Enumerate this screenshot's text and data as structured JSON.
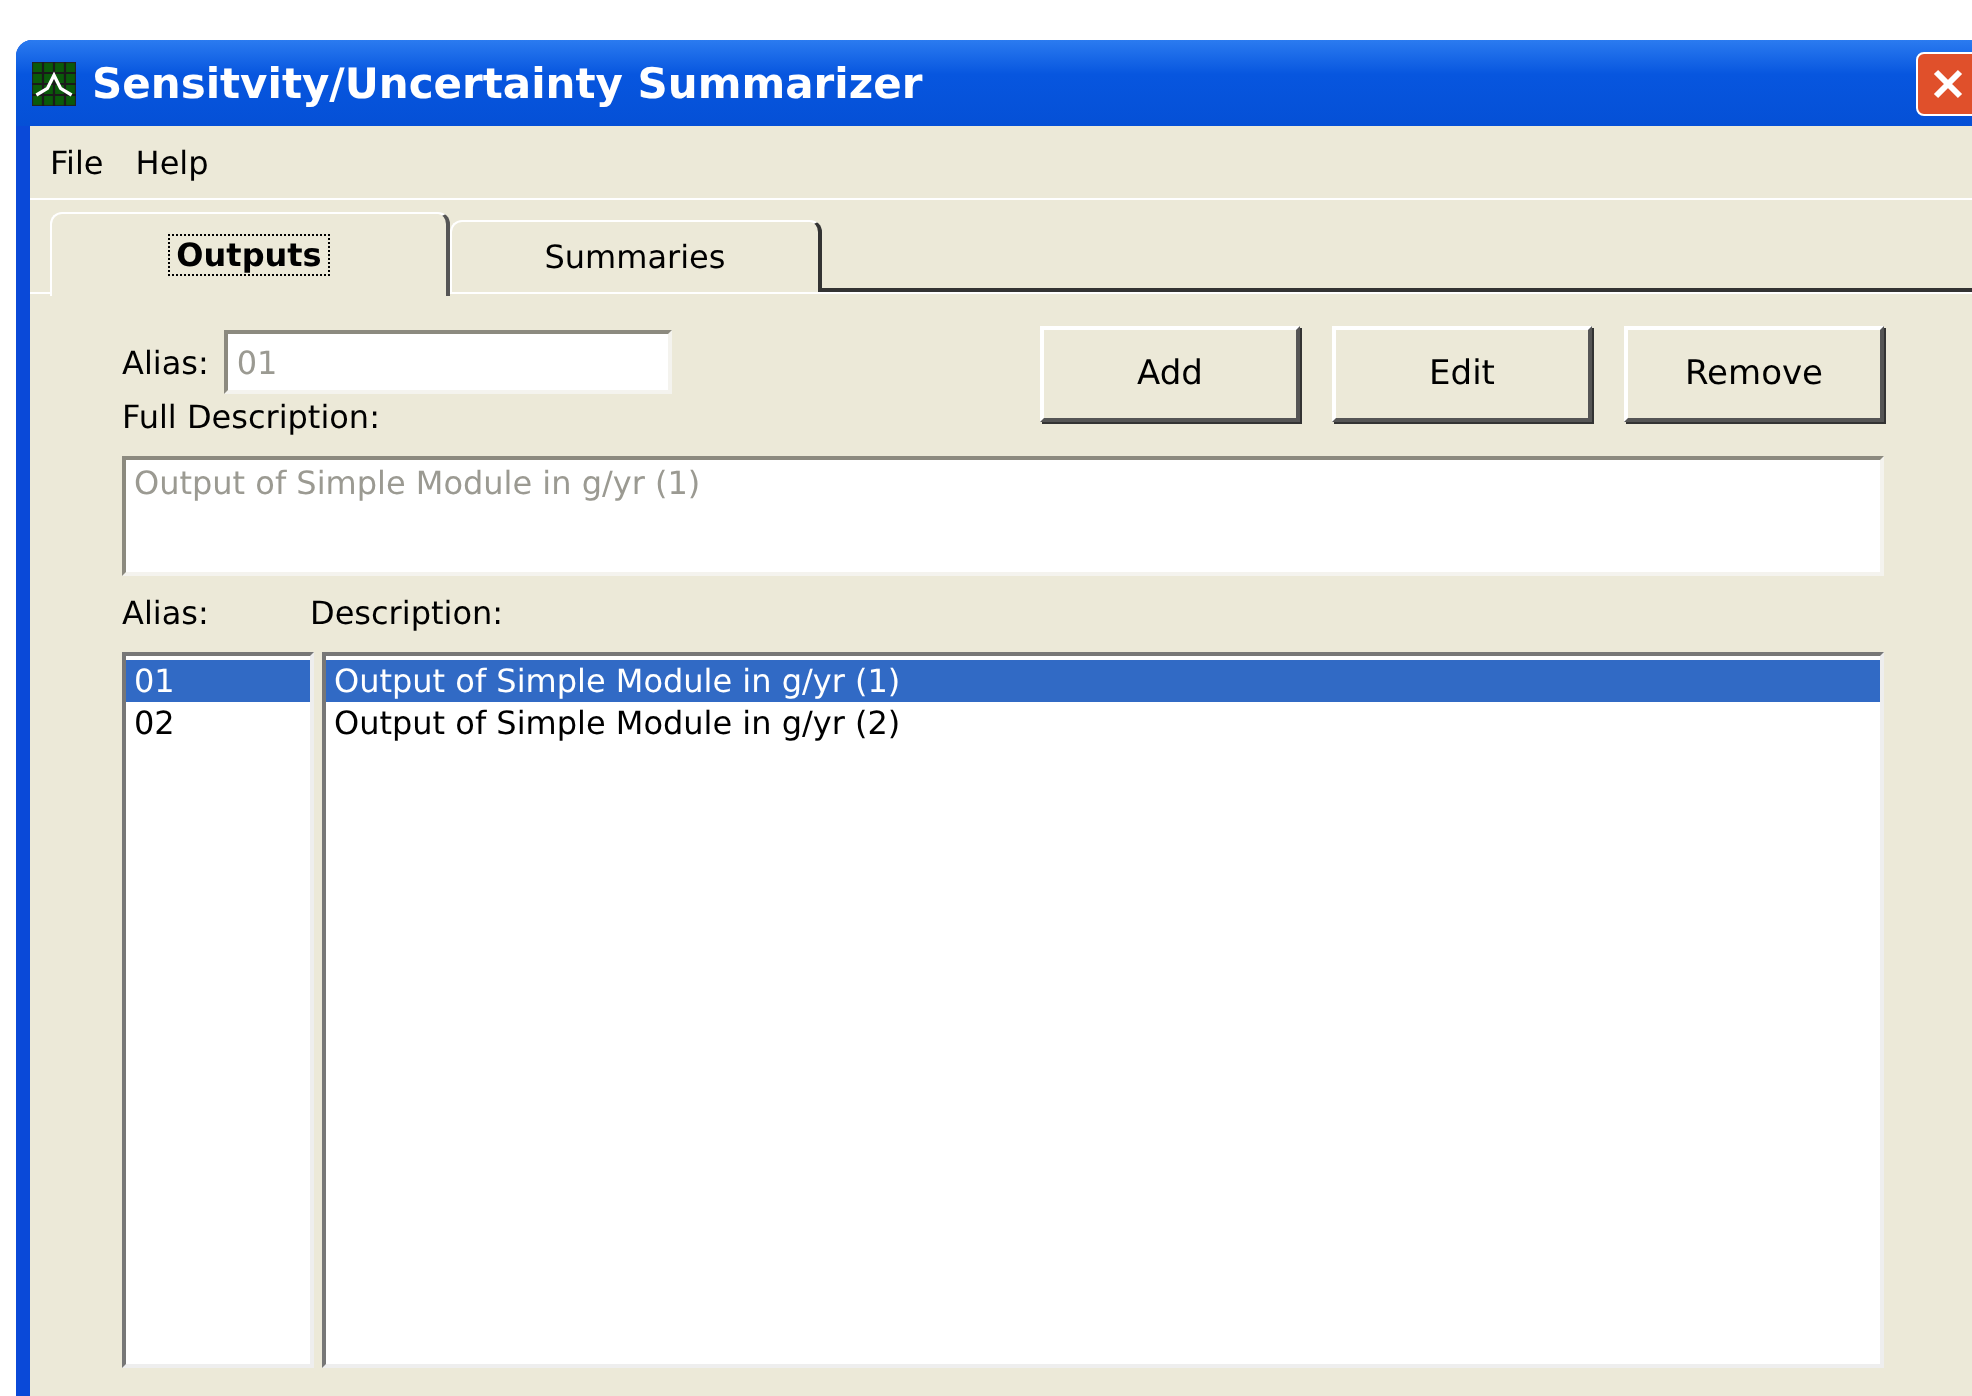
{
  "window": {
    "title": "Sensitvity/Uncertainty Summarizer"
  },
  "menu": [
    "File",
    "Help"
  ],
  "tabs": [
    {
      "label": "Outputs",
      "selected": true
    },
    {
      "label": "Summaries",
      "selected": false
    }
  ],
  "alias_field": {
    "label": "Alias:",
    "value": "01",
    "disabled": true
  },
  "description_field": {
    "label": "Full Description:",
    "value": "Output of Simple Module in g/yr (1)",
    "disabled": true
  },
  "buttons": [
    "Add",
    "Edit",
    "Remove"
  ],
  "list": {
    "alias_header": "Alias:",
    "description_header": "Description:",
    "rows": [
      {
        "alias": "01",
        "description": "Output of Simple Module in g/yr (1)",
        "selected": true
      },
      {
        "alias": "02",
        "description": "Output of Simple Module in g/yr (2)",
        "selected": false
      }
    ]
  }
}
